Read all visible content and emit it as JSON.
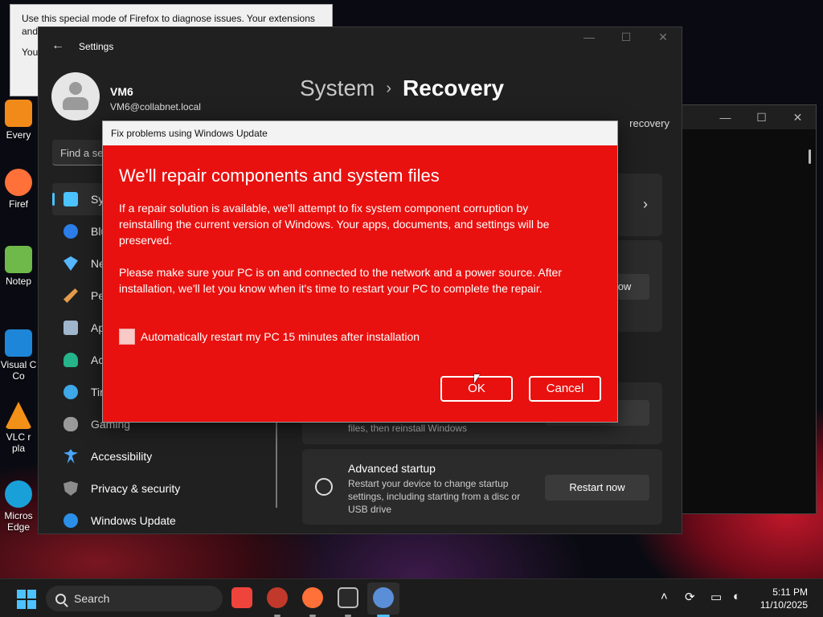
{
  "firefox_tip": {
    "line1": "Use this special mode of Firefox to diagnose issues. Your extensions",
    "line2": "and",
    "line3": "You"
  },
  "desktop_icons": [
    {
      "label": "Every",
      "color": "#f28a1a"
    },
    {
      "label": "Firef",
      "color": "#ff7139"
    },
    {
      "label": "Notep",
      "color": "#6fb84a"
    },
    {
      "label": "Visual C",
      "label2": "Co",
      "color": "#1e86d8"
    },
    {
      "label": "VLC r",
      "label2": "pla",
      "color": "#f39018"
    },
    {
      "label": "Micros",
      "label2": "Edge",
      "color": "#1aa0d8"
    }
  ],
  "settings": {
    "title": "Settings",
    "back_icon": "back-arrow-icon",
    "window_controls": [
      "—",
      "☐",
      "✕"
    ],
    "profile": {
      "name": "VM6",
      "email": "VM6@collabnet.local"
    },
    "search_placeholder": "Find a se",
    "nav": [
      {
        "label": "Sys",
        "icon": "system-icon",
        "color": "#4cc2ff",
        "active": true
      },
      {
        "label": "Blu",
        "icon": "bluetooth-icon",
        "color": "#2b7de9"
      },
      {
        "label": "Net",
        "icon": "wifi-icon",
        "color": "#55b7ff"
      },
      {
        "label": "Per",
        "icon": "brush-icon",
        "color": "#e39b4a"
      },
      {
        "label": "App",
        "icon": "apps-icon",
        "color": "#9fb6cc"
      },
      {
        "label": "Acc",
        "icon": "accounts-icon",
        "color": "#26b48a"
      },
      {
        "label": "Tim",
        "icon": "time-icon",
        "color": "#3fa8e8"
      },
      {
        "label": "Gaming",
        "icon": "gaming-icon",
        "color": "#9a9a9a"
      },
      {
        "label": "Accessibility",
        "icon": "accessibility-icon",
        "color": "#4aa6ff"
      },
      {
        "label": "Privacy & security",
        "icon": "shield-icon",
        "color": "#8c8c8c"
      },
      {
        "label": "Windows Update",
        "icon": "update-icon",
        "color": "#2b8fe8"
      }
    ],
    "breadcrumb": {
      "parent": "System",
      "separator": "›",
      "current": "Recovery"
    },
    "description_fragment": "recovery",
    "card_reset_button": "ow",
    "card_reinstall_desc": "files, then reinstall Windows",
    "advanced_startup": {
      "title": "Advanced startup",
      "description": "Restart your device to change startup settings, including starting from a disc or USB drive",
      "button": "Restart now"
    }
  },
  "dialog": {
    "title": "Fix problems using Windows Update",
    "heading": "We'll repair components and system files",
    "paragraph1": "If a repair solution is available, we'll attempt to fix system component corruption by reinstalling the current version of Windows. Your apps, documents, and settings will be preserved.",
    "paragraph2": "Please make sure your PC is on and connected to the network and a power source. After installation, we'll let you know when it's time to restart your PC to complete the repair.",
    "checkbox_label": "Automatically restart my PC 15 minutes after installation",
    "checkbox_checked": false,
    "ok_label": "OK",
    "cancel_label": "Cancel",
    "accent": "#e8110f"
  },
  "taskbar": {
    "search_label": "Search",
    "apps": [
      {
        "name": "anydesk-icon",
        "color": "#ef443b"
      },
      {
        "name": "app-red-icon",
        "color": "#c0392b"
      },
      {
        "name": "firefox-icon",
        "color": "#ff7139"
      },
      {
        "name": "terminal-icon",
        "color": "#2a2a2a"
      },
      {
        "name": "settings-icon",
        "color": "#5a8fd8"
      }
    ],
    "time": "5:11 PM",
    "date": "11/10/2025"
  }
}
